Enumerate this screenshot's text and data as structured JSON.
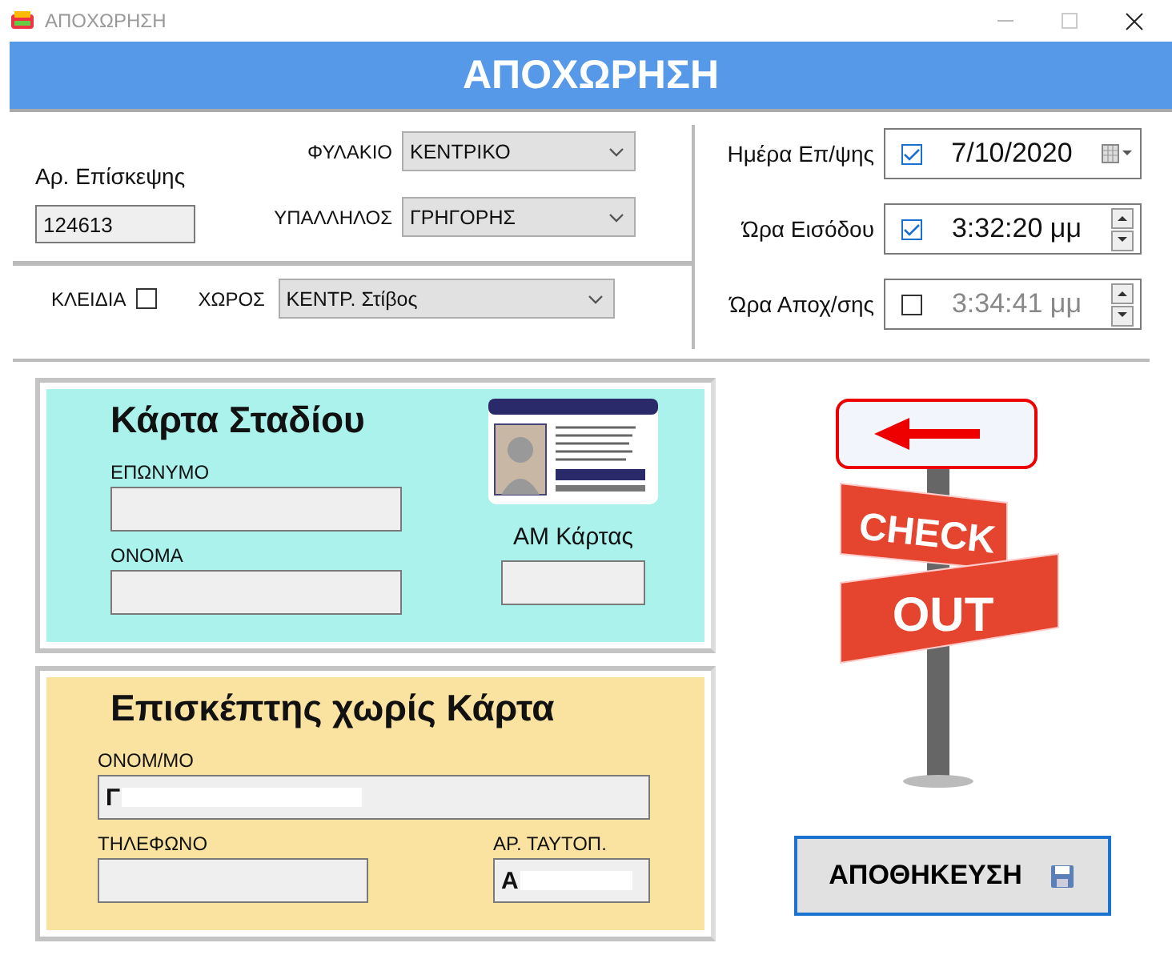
{
  "window": {
    "title": "ΑΠΟΧΩΡΗΣΗ"
  },
  "header": {
    "title": "ΑΠΟΧΩΡΗΣΗ"
  },
  "visit": {
    "label": "Αρ. Επίσκεψης",
    "value": "124613"
  },
  "selects": [
    {
      "label": "ΦΥΛΑΚΙΟ",
      "value": "ΚΕΝΤΡΙΚΟ"
    },
    {
      "label": "ΥΠΑΛΛΗΛΟΣ",
      "value": "ΓΡΗΓΟΡΗΣ"
    }
  ],
  "keys": {
    "label": "ΚΛΕΙΔΙΑ",
    "checked": false
  },
  "area": {
    "label": "ΧΩΡΟΣ",
    "value": "ΚΕΝΤΡ. Στίβος"
  },
  "datetimes": [
    {
      "kind": "date",
      "label": "Ημέρα Επ/ψης",
      "value": "7/10/2020",
      "checked": true
    },
    {
      "kind": "time",
      "label": "Ώρα Εισόδου",
      "value": "3:32:20 μμ",
      "checked": true
    },
    {
      "kind": "time",
      "label": "Ώρα Αποχ/σης",
      "value": "3:34:41 μμ",
      "checked": false
    }
  ],
  "stadium_card": {
    "title": "Κάρτα Σταδίου",
    "fields": [
      {
        "label": "ΕΠΩΝΥΜΟ"
      },
      {
        "label": "ΟΝΟΜΑ"
      }
    ],
    "card_number": {
      "label": "ΑΜ Κάρτας"
    }
  },
  "visitor": {
    "title": "Επισκέπτης χωρίς Κάρτα",
    "name": {
      "label": "ΟΝΟΜ/ΜΟ",
      "value": "Γ"
    },
    "phone": {
      "label": "ΤΗΛΕΦΩΝΟ"
    },
    "id_number": {
      "label": "ΑΡ. ΤΑΥΤΟΠ.",
      "value": "Α"
    }
  },
  "sign": {
    "words": [
      "CHECK",
      "OUT"
    ]
  },
  "save_button": {
    "label": "ΑΠΟΘΗΚΕΥΣΗ"
  }
}
